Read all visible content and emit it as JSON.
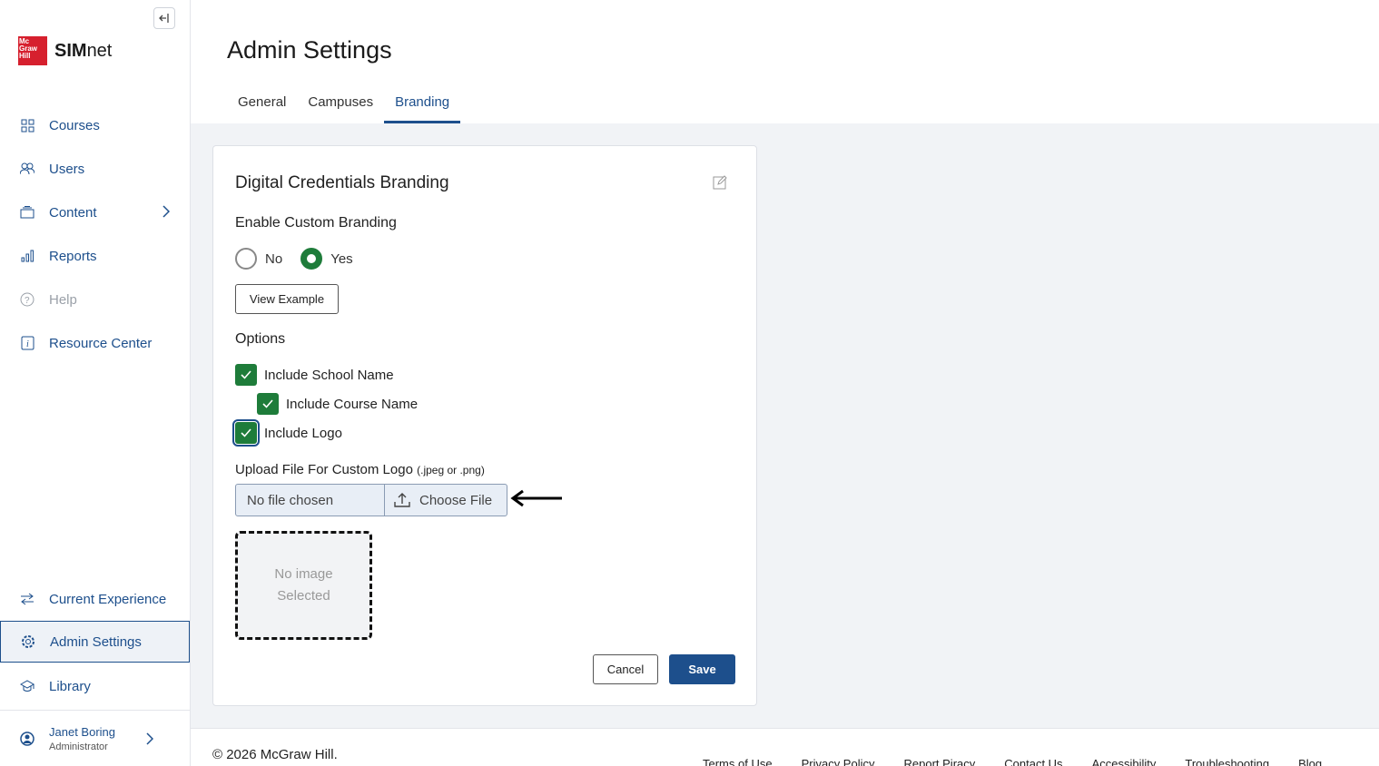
{
  "sidebar": {
    "logo_brand": "Mc Graw Hill",
    "logo_product_bold": "SIM",
    "logo_product_light": "net",
    "items": [
      {
        "label": "Courses",
        "icon": "grid-icon"
      },
      {
        "label": "Users",
        "icon": "users-icon"
      },
      {
        "label": "Content",
        "icon": "layers-icon"
      },
      {
        "label": "Reports",
        "icon": "bar-chart-icon"
      },
      {
        "label": "Help",
        "icon": "help-icon"
      },
      {
        "label": "Resource Center",
        "icon": "info-icon"
      }
    ],
    "bottom_items": [
      {
        "label": "Current Experience",
        "icon": "swap-icon"
      },
      {
        "label": "Admin Settings",
        "icon": "gear-icon"
      },
      {
        "label": "Library",
        "icon": "graduation-cap-icon"
      }
    ],
    "user": {
      "name": "Janet Boring",
      "role": "Administrator"
    }
  },
  "header": {
    "title": "Admin Settings",
    "tabs": [
      {
        "label": "General"
      },
      {
        "label": "Campuses"
      },
      {
        "label": "Branding"
      }
    ],
    "active_tab": "Branding"
  },
  "card": {
    "title": "Digital Credentials Branding",
    "enable_label": "Enable Custom Branding",
    "radio_no": "No",
    "radio_yes": "Yes",
    "selected_radio": "Yes",
    "view_example": "View Example",
    "options_label": "Options",
    "options": [
      {
        "label": "Include School Name",
        "checked": true
      },
      {
        "label": "Include Course Name",
        "checked": true
      },
      {
        "label": "Include Logo",
        "checked": true
      }
    ],
    "upload_label": "Upload File For Custom Logo",
    "upload_hint": "(.jpeg or .png)",
    "file_status": "No file chosen",
    "choose_file": "Choose File",
    "preview_line1": "No image",
    "preview_line2": "Selected",
    "cancel": "Cancel",
    "save": "Save"
  },
  "footer": {
    "copyright": "© 2026 McGraw Hill.",
    "links": [
      "Terms of Use",
      "Privacy Policy",
      "Report Piracy",
      "Contact Us",
      "Accessibility",
      "Troubleshooting",
      "Blog"
    ]
  },
  "colors": {
    "accent": "#1d4f8c",
    "success": "#1e7c3a",
    "brand_red": "#d6202e"
  }
}
